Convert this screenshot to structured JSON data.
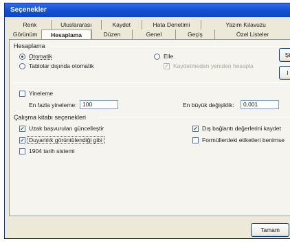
{
  "window": {
    "title": "Seçenekler"
  },
  "tabs": {
    "row1": [
      "Renk",
      "Uluslararası",
      "Kaydet",
      "Hata Denetimi",
      "Yazım Kılavuzu"
    ],
    "row2": [
      "Görünüm",
      "Hesaplama",
      "Düzen",
      "Genel",
      "Geçiş",
      "Özel Listeler"
    ],
    "active": "Hesaplama"
  },
  "calculation": {
    "group_label": "Hesaplama",
    "automatic_label": "Otomatik",
    "automatic_checked": true,
    "auto_except_tables_label": "Tablolar dışında otomatik",
    "auto_except_tables_checked": false,
    "manual_label": "Elle",
    "manual_checked": false,
    "recalc_before_save_label": "Kaydetmeden yeniden hesapla",
    "recalc_before_save_checked": true,
    "recalc_before_save_enabled": false,
    "calc_now_button": "Şi",
    "calc_sheet_button": "l"
  },
  "iteration": {
    "label": "Yineleme",
    "checked": false,
    "max_iterations_label": "En fazla yineleme:",
    "max_iterations_value": "100",
    "max_change_label": "En büyük değişiklik:",
    "max_change_value": "0,001"
  },
  "workbook": {
    "group_label": "Çalışma kitabı seçenekleri",
    "update_remote_refs_label": "Uzak başvuruları güncelleştir",
    "update_remote_refs_checked": true,
    "precision_as_displayed_label": "Duyarlılık görüntülendiği gibi",
    "precision_as_displayed_checked": true,
    "date_1904_label": "1904 tarih sistemi",
    "date_1904_checked": false,
    "save_external_links_label": "Dış bağlantı değerlerini kaydet",
    "save_external_links_checked": true,
    "accept_labels_label": "Formüllerdeki etiketleri benimse",
    "accept_labels_checked": false
  },
  "footer": {
    "ok_button": "Tamam"
  }
}
